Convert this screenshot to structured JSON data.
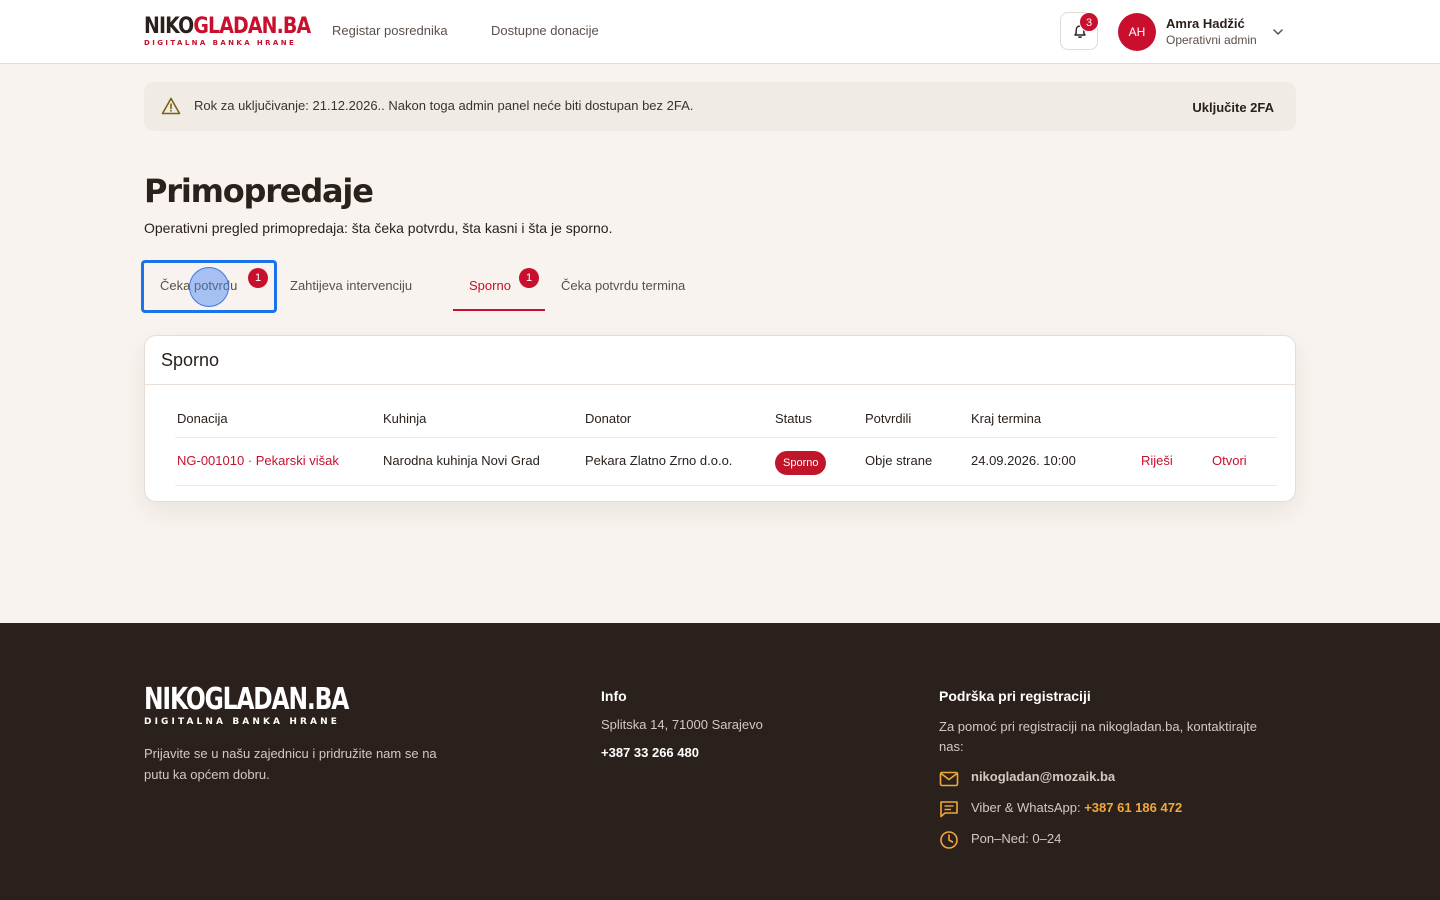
{
  "header": {
    "logo_main_dark": "NIKO",
    "logo_main_red": "GLADAN.BA",
    "logo_sub": "DIGITALNA BANKA HRANE",
    "nav": [
      "Registar posrednika",
      "Dostupne donacije"
    ],
    "notification_count": "3",
    "user": {
      "initials": "AH",
      "name": "Amra Hadžić",
      "role": "Operativni admin"
    }
  },
  "alert": {
    "text": "Rok za uključivanje: 21.12.2026.. Nakon toga admin panel neće biti dostupan bez 2FA.",
    "action": "Uključite 2FA"
  },
  "page": {
    "title": "Primopredaje",
    "subtitle": "Operativni pregled primopredaja: šta čeka potvrdu, šta kasni i šta je sporno."
  },
  "tabs": [
    {
      "label": "Čeka potvrdu",
      "badge": "1",
      "focused": true
    },
    {
      "label": "Zahtijeva intervenciju"
    },
    {
      "label": "Sporno",
      "badge": "1",
      "active": true
    },
    {
      "label": "Čeka potvrdu termina"
    }
  ],
  "card": {
    "title": "Sporno",
    "columns": [
      "Donacija",
      "Kuhinja",
      "Donator",
      "Status",
      "Potvrdili",
      "Kraj termina"
    ],
    "rows": [
      {
        "donacija": "NG-001010 · Pekarski višak",
        "kuhinja": "Narodna kuhinja Novi Grad",
        "donator": "Pekara Zlatno Zrno d.o.o.",
        "status": "Sporno",
        "potvrdili": "Obje strane",
        "kraj": "24.09.2026. 10:00",
        "actions": [
          "Riješi",
          "Otvori"
        ]
      }
    ]
  },
  "footer": {
    "logo_main": "NIKOGLADAN.BA",
    "logo_sub": "DIGITALNA BANKA HRANE",
    "tagline": "Prijavite se u našu zajednicu i pridružite nam se na putu ka općem dobru.",
    "info": {
      "title": "Info",
      "address": "Splitska 14, 71000 Sarajevo",
      "phone": "+387 33 266 480"
    },
    "support": {
      "title": "Podrška pri registraciji",
      "text": "Za pomoć pri registraciji na nikogladan.ba, kontaktirajte nas:",
      "email": "nikogladan@mozaik.ba",
      "viber_label": "Viber & WhatsApp: ",
      "viber_number": "+387 61 186 472",
      "hours": "Pon–Ned: 0–24"
    }
  },
  "colors": {
    "brand_red": "#c8102e",
    "footer_bg": "#2b211c",
    "page_bg": "#f8f3ee",
    "focus_blue": "#1a73e8",
    "footer_accent": "#f0a83c"
  },
  "icons": [
    "bell-icon",
    "chevron-down-icon",
    "warning-icon",
    "mail-icon",
    "chat-icon",
    "clock-icon"
  ]
}
